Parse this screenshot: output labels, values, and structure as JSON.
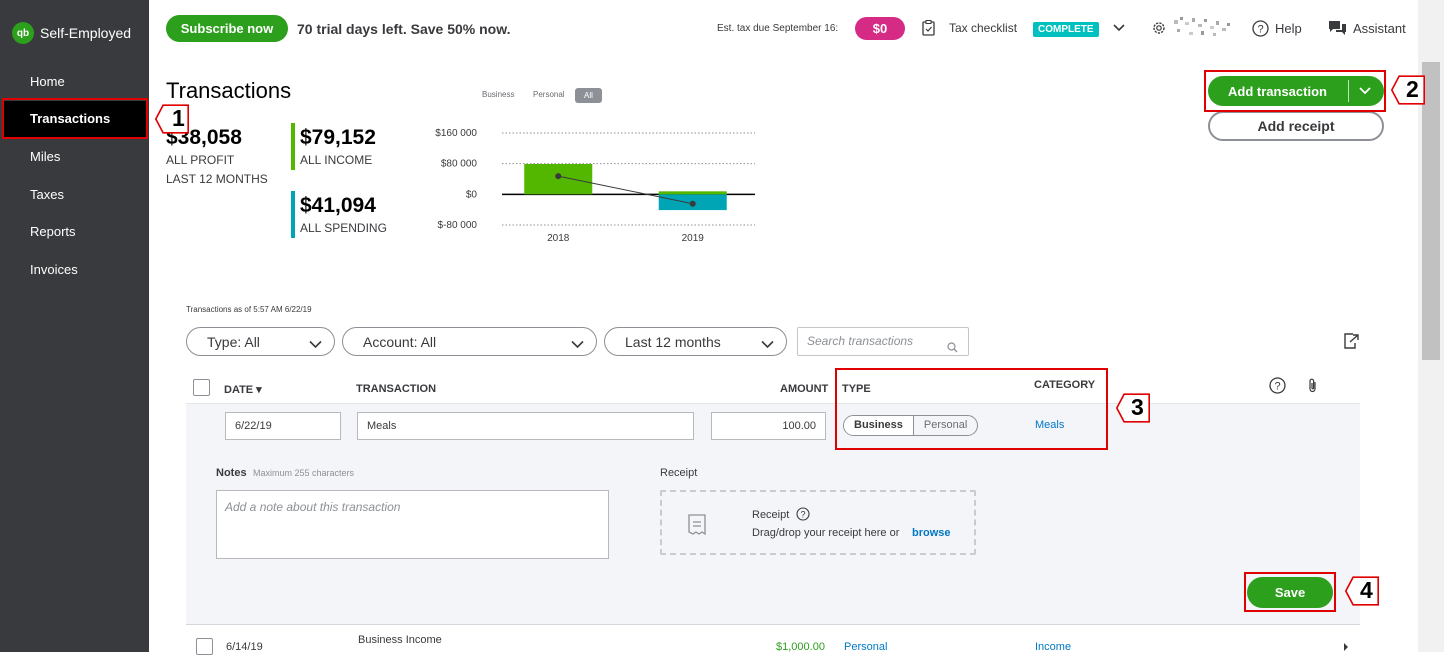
{
  "brand": {
    "logo_text": "qb",
    "name": "Self-Employed"
  },
  "sidebar": {
    "items": [
      {
        "label": "Home"
      },
      {
        "label": "Transactions"
      },
      {
        "label": "Miles"
      },
      {
        "label": "Taxes"
      },
      {
        "label": "Reports"
      },
      {
        "label": "Invoices"
      }
    ]
  },
  "topbar": {
    "subscribe_label": "Subscribe now",
    "trial_text": "70 trial days left. Save 50% now.",
    "est_tax_label": "Est. tax due September 16:",
    "est_tax_value": "$0",
    "tax_checklist_label": "Tax checklist",
    "complete_badge": "COMPLETE",
    "help_label": "Help",
    "assistant_label": "Assistant"
  },
  "page": {
    "title": "Transactions",
    "add_transaction_label": "Add transaction",
    "add_receipt_label": "Add receipt"
  },
  "summary": {
    "profit_value": "$38,058",
    "profit_label": "ALL PROFIT",
    "profit_period": "LAST 12 MONTHS",
    "income_value": "$79,152",
    "income_label": "ALL INCOME",
    "spending_value": "$41,094",
    "spending_label": "ALL SPENDING"
  },
  "chart_data": {
    "type": "bar",
    "toggle_options": [
      "Business",
      "Personal",
      "All"
    ],
    "toggle_selected": "All",
    "categories": [
      "2018",
      "2019"
    ],
    "series": [
      {
        "name": "Income",
        "values": [
          79152,
          0
        ]
      },
      {
        "name": "Spending",
        "values": [
          0,
          -41094
        ]
      }
    ],
    "profit_line": [
      79152,
      -41094
    ],
    "y_ticks": [
      "$160 000",
      "$80 000",
      "$0",
      "$-80 000"
    ],
    "ylim": [
      -80000,
      160000
    ],
    "colors": {
      "income": "#53b700",
      "spending": "#00a5b5"
    }
  },
  "table": {
    "as_of": "Transactions as of 5:57 AM 6/22/19",
    "filters": {
      "type": "Type: All",
      "account": "Account: All",
      "period": "Last 12 months"
    },
    "search_placeholder": "Search transactions",
    "headers": {
      "date": "DATE ▾",
      "transaction": "TRANSACTION",
      "amount": "AMOUNT",
      "type": "TYPE",
      "category": "CATEGORY"
    },
    "edit_row": {
      "date": "6/22/19",
      "transaction": "Meals",
      "amount": "100.00",
      "type_business": "Business",
      "type_personal": "Personal",
      "category": "Meals"
    },
    "notes_label": "Notes",
    "notes_hint": "Maximum 255 characters",
    "notes_placeholder": "Add a note about this transaction",
    "receipt_label": "Receipt",
    "receipt_box_title": "Receipt",
    "receipt_box_text": "Drag/drop your receipt here or",
    "receipt_browse": "browse",
    "save_label": "Save",
    "rows": [
      {
        "date": "6/14/19",
        "transaction": "Business Income",
        "amount": "$1,000.00",
        "type": "Personal",
        "category": "Income"
      }
    ]
  },
  "callouts": [
    "1",
    "2",
    "3",
    "4"
  ]
}
